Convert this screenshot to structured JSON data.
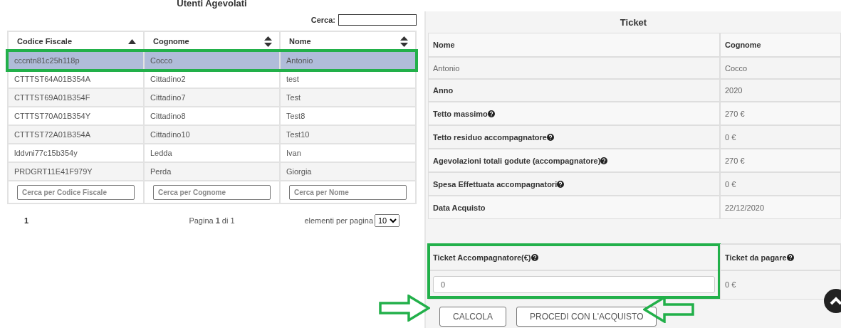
{
  "users_panel": {
    "title": "Utenti Agevolati",
    "search_label": "Cerca:",
    "columns": [
      {
        "label": "Codice Fiscale",
        "sorted": true
      },
      {
        "label": "Cognome",
        "sorted": false
      },
      {
        "label": "Nome",
        "sorted": false
      }
    ],
    "rows": [
      {
        "cells": [
          "cccntn81c25h118p",
          "Cocco",
          "Antonio"
        ],
        "selected": true
      },
      {
        "cells": [
          "CTTTST64A01B354A",
          "Cittadino2",
          "test"
        ],
        "selected": false
      },
      {
        "cells": [
          "CTTTST69A01B354F",
          "Cittadino7",
          "Test"
        ],
        "selected": false
      },
      {
        "cells": [
          "CTTTST70A01B354Y",
          "Cittadino8",
          "Test8"
        ],
        "selected": false
      },
      {
        "cells": [
          "CTTTST72A01B354A",
          "Cittadino10",
          "Test10"
        ],
        "selected": false
      },
      {
        "cells": [
          "lddvni77c15b354y",
          "Ledda",
          "Ivan"
        ],
        "selected": false
      },
      {
        "cells": [
          "PRDGRT11E41F979Y",
          "Perda",
          "Giorgia"
        ],
        "selected": false
      }
    ],
    "filters": [
      {
        "placeholder": "Cerca per Codice Fiscale"
      },
      {
        "placeholder": "Cerca per Cognome"
      },
      {
        "placeholder": "Cerca per Nome"
      }
    ],
    "pagination": {
      "page_link": "1",
      "page_info": "Pagina **1** di 1",
      "per_page_label": "elementi per pagina",
      "per_page_value": "10"
    }
  },
  "ticket_panel": {
    "title": "Ticket",
    "columns": [
      "Nome",
      "Cognome"
    ],
    "person": [
      "Antonio",
      "Cocco"
    ],
    "rows": [
      {
        "label": "Anno",
        "help": false,
        "value": "2020"
      },
      {
        "label": "Tetto massimo",
        "help": true,
        "value": "270 €"
      },
      {
        "label": "Tetto residuo accompagnatore",
        "help": true,
        "value": "0 €"
      },
      {
        "label": "Agevolazioni totali godute (accompagnatore)",
        "help": true,
        "value": "270 €"
      },
      {
        "label": "Spesa Effettuata accompagnatori",
        "help": true,
        "value": "0 €"
      },
      {
        "label": "Data Acquisto",
        "help": false,
        "value": "22/12/2020"
      }
    ],
    "ticket_input": {
      "label": "Ticket Accompagnatore(€)",
      "help": true,
      "value": "0"
    },
    "ticket_due": {
      "label": "Ticket da pagare",
      "help": true,
      "value": "0 €"
    },
    "buttons": [
      "CALCOLA",
      "PROCEDI CON L'ACQUISTO"
    ]
  }
}
